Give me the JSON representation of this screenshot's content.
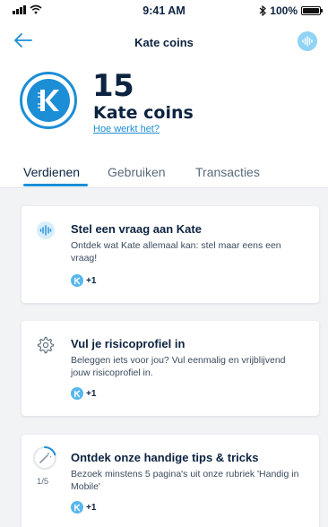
{
  "status_bar": {
    "time": "9:41 AM",
    "battery": "100%",
    "battery_fraction": 1.0
  },
  "navbar": {
    "title": "Kate coins"
  },
  "balance": {
    "amount": "15",
    "unit": "Kate coins",
    "how_link": "Hoe werkt het?"
  },
  "tabs": [
    {
      "label": "Verdienen",
      "active": true
    },
    {
      "label": "Gebruiken",
      "active": false
    },
    {
      "label": "Transacties",
      "active": false
    }
  ],
  "cards": [
    {
      "icon": "voice-wave-icon",
      "title": "Stel een vraag aan Kate",
      "description": "Ontdek wat Kate allemaal kan: stel maar eens een vraag!",
      "reward": "+1"
    },
    {
      "icon": "gear-icon",
      "title": "Vul je risicoprofiel in",
      "description": "Beleggen iets voor jou? Vul eenmalig en vrijblijvend jouw risicoprofiel in.",
      "reward": "+1"
    },
    {
      "icon": "magic-wand-icon",
      "title": "Ontdek onze handige tips & tricks",
      "description": "Bezoek minstens 5 pagina's uit onze rubriek 'Handig in Mobile'",
      "reward": "+1",
      "progress": "1/5",
      "progress_fraction": 0.2
    }
  ],
  "colors": {
    "accent": "#1c8ed6",
    "text": "#0c2340",
    "background": "#f2f3f5",
    "coin_light": "#57b7ee"
  }
}
